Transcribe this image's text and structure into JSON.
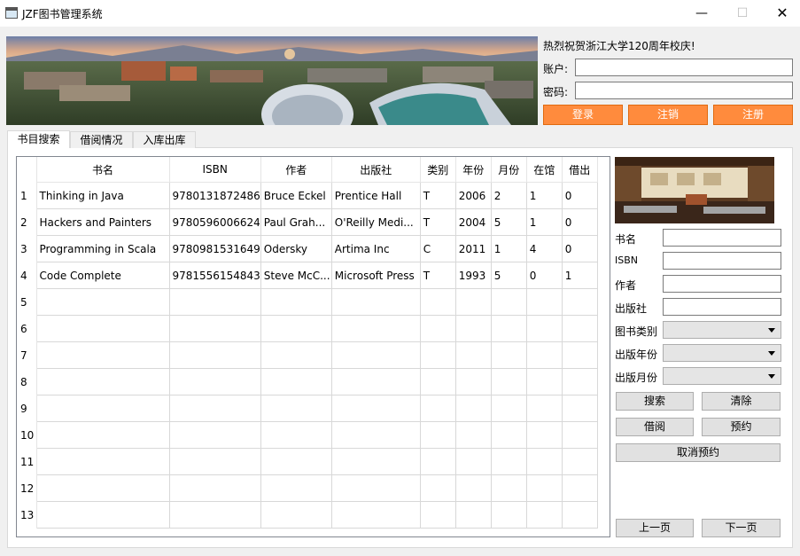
{
  "window": {
    "title": "JZF图书管理系统",
    "min": "—",
    "max": "☐",
    "close": "✕"
  },
  "login": {
    "greeting": "热烈祝贺浙江大学120周年校庆!",
    "account_label": "账户:",
    "password_label": "密码:",
    "account_value": "",
    "password_value": "",
    "buttons": {
      "login": "登录",
      "logout": "注销",
      "register": "注册"
    },
    "button_color": "#ff8b3d"
  },
  "tabs": [
    "书目搜索",
    "借阅情况",
    "入库出库"
  ],
  "table": {
    "headers": [
      "书名",
      "ISBN",
      "作者",
      "出版社",
      "类别",
      "年份",
      "月份",
      "在馆",
      "借出"
    ],
    "row_numbers": [
      "1",
      "2",
      "3",
      "4",
      "5",
      "6",
      "7",
      "8",
      "9",
      "10",
      "11",
      "12",
      "13"
    ],
    "rows": [
      [
        "Thinking in Java",
        "9780131872486",
        "Bruce Eckel",
        "Prentice Hall",
        "T",
        "2006",
        "2",
        "1",
        "0"
      ],
      [
        "Hackers and Painters",
        "9780596006624",
        "Paul Grah...",
        "O'Reilly Medi...",
        "T",
        "2004",
        "5",
        "1",
        "0"
      ],
      [
        "Programming in Scala",
        "9780981531649",
        "Odersky",
        "Artima Inc",
        "C",
        "2011",
        "1",
        "4",
        "0"
      ],
      [
        "Code Complete",
        "9781556154843",
        "Steve McC...",
        "Microsoft Press",
        "T",
        "1993",
        "5",
        "0",
        "1"
      ]
    ]
  },
  "search_form": {
    "title_label": "书名",
    "isbn_label": "ISBN",
    "author_label": "作者",
    "publisher_label": "出版社",
    "category_label": "图书类别",
    "year_label": "出版年份",
    "month_label": "出版月份",
    "category_value": "",
    "year_value": "",
    "month_value": ""
  },
  "actions": {
    "search": "搜索",
    "clear": "清除",
    "borrow": "借阅",
    "reserve": "预约",
    "cancel_reserve": "取消预约",
    "prev_page": "上一页",
    "next_page": "下一页"
  }
}
